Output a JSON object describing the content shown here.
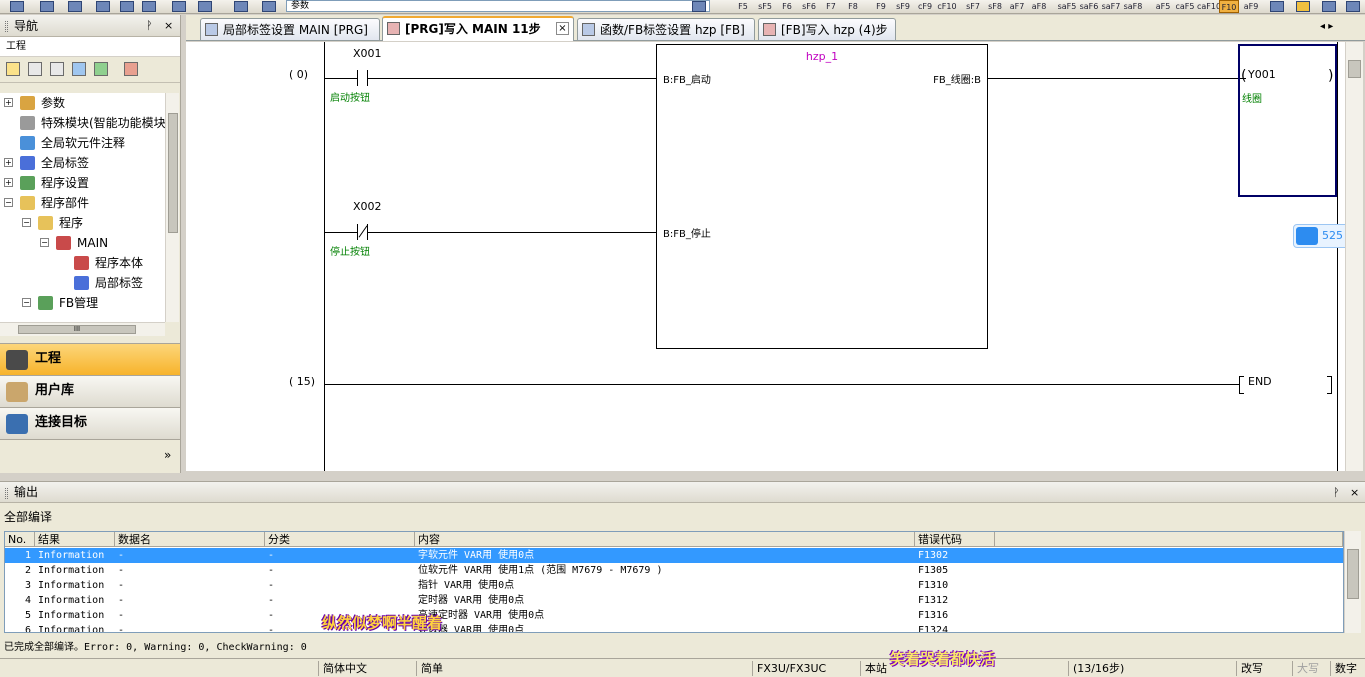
{
  "toolbar": {
    "combo_value": "参数",
    "keys": [
      "F5",
      "sF5",
      "F6",
      "sF6",
      "F7",
      "F8",
      "F9",
      "sF9",
      "cF9",
      "cF10",
      "sF7",
      "sF8",
      "aF7",
      "aF8",
      "saF5",
      "saF6",
      "saF7",
      "saF8",
      "aF5",
      "caF5",
      "caF10",
      "F10",
      "aF9"
    ]
  },
  "nav": {
    "title": "导航",
    "pin": "ᚹ",
    "close": "×",
    "section": "工程",
    "tree": [
      {
        "label": "参数"
      },
      {
        "label": "特殊模块(智能功能模块"
      },
      {
        "label": "全局软元件注释"
      },
      {
        "label": "全局标签"
      },
      {
        "label": "程序设置"
      },
      {
        "label": "程序部件"
      },
      {
        "label": "程序"
      },
      {
        "label": "MAIN"
      },
      {
        "label": "程序本体"
      },
      {
        "label": "局部标签"
      },
      {
        "label": "FB管理"
      }
    ],
    "hscroll_glyph": "III",
    "buttons": [
      {
        "label": "工程"
      },
      {
        "label": "用户库"
      },
      {
        "label": "连接目标"
      }
    ],
    "more": "»"
  },
  "tabs": [
    {
      "label": "局部标签设置 MAIN [PRG]"
    },
    {
      "label": "[PRG]写入 MAIN 11步"
    },
    {
      "label": "函数/FB标签设置 hzp [FB]"
    },
    {
      "label": "[FB]写入 hzp (4)步"
    }
  ],
  "tab_close": "×",
  "tab_nav": "◂ ▸",
  "ladder": {
    "step0": "(    0)",
    "step15": "(   15)",
    "x001": "X001",
    "x001_comment": "启动按钮",
    "x002": "X002",
    "x002_comment": "停止按钮",
    "fb_name": "hzp_1",
    "fb_in1": "B:FB_启动",
    "fb_in2": "B:FB_停止",
    "fb_out": "FB_线圈:B",
    "coil": "Y001",
    "coil_comment": "线圈",
    "end": "END"
  },
  "cloud_badge": "525",
  "output": {
    "title": "输出",
    "subtitle": "全部编译",
    "columns": [
      "No.",
      "结果",
      "数据名",
      "分类",
      "内容",
      "错误代码"
    ],
    "rows": [
      {
        "no": "1",
        "result": "Information",
        "data": "-",
        "cat": "-",
        "content": "字软元件 VAR用 使用0点",
        "code": "F1302"
      },
      {
        "no": "2",
        "result": "Information",
        "data": "-",
        "cat": "-",
        "content": "位软元件 VAR用 使用1点 (范围 M7679 - M7679 )",
        "code": "F1305"
      },
      {
        "no": "3",
        "result": "Information",
        "data": "-",
        "cat": "-",
        "content": "指针 VAR用 使用0点",
        "code": "F1310"
      },
      {
        "no": "4",
        "result": "Information",
        "data": "-",
        "cat": "-",
        "content": "定时器 VAR用 使用0点",
        "code": "F1312"
      },
      {
        "no": "5",
        "result": "Information",
        "data": "-",
        "cat": "-",
        "content": "高速定时器 VAR用 使用0点",
        "code": "F1316"
      },
      {
        "no": "6",
        "result": "Information",
        "data": "-",
        "cat": "-",
        "content": "计数器 VAR用 使用0点",
        "code": "F1324"
      }
    ],
    "summary": "已完成全部编译。Error: 0, Warning: 0, CheckWarning: 0"
  },
  "status": {
    "lang": "简体中文",
    "mode": "简单",
    "plc": "FX3U/FX3UC",
    "station": "本站",
    "steps": "(13/16步)",
    "overwrite": "改写",
    "caps": "大写",
    "num": "数字"
  },
  "overlays": {
    "text1": "纵然似梦啊半醒着",
    "text2": "笑着哭着都快活"
  },
  "colors": {
    "selected_row": "#3399ff",
    "comment_green": "#008000",
    "fb_name_magenta": "#c000c0",
    "active_nav": "#f7b32b"
  }
}
